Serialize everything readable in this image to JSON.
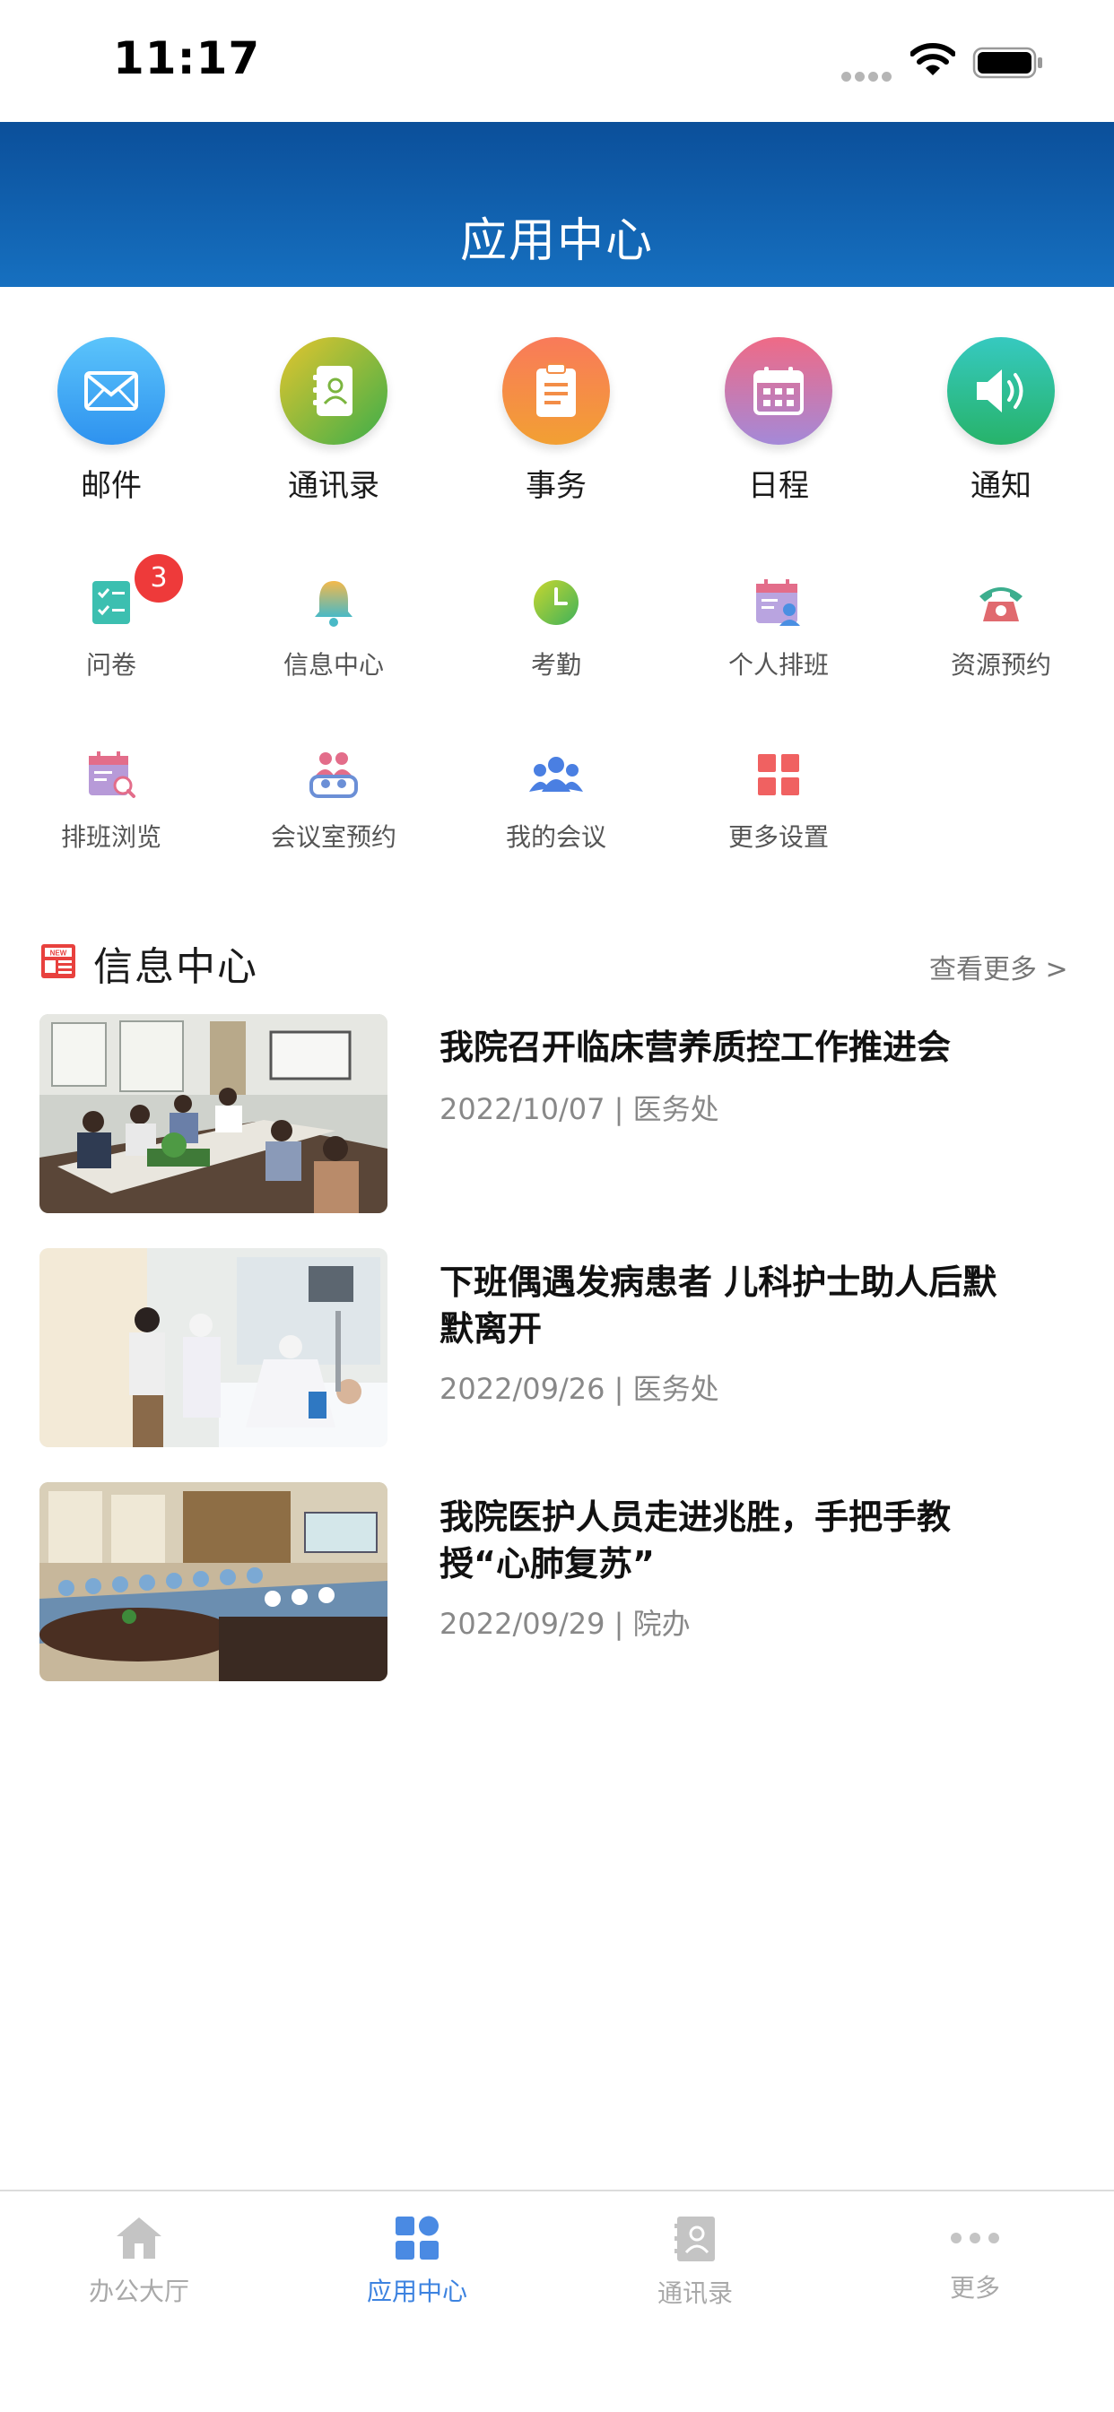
{
  "status_bar": {
    "time": "11:17"
  },
  "header": {
    "title": "应用中心"
  },
  "primary_apps": [
    {
      "label": "邮件",
      "icon": "mail-icon"
    },
    {
      "label": "通讯录",
      "icon": "contacts-icon"
    },
    {
      "label": "事务",
      "icon": "clipboard-icon"
    },
    {
      "label": "日程",
      "icon": "calendar-icon"
    },
    {
      "label": "通知",
      "icon": "speaker-icon"
    }
  ],
  "secondary_apps": [
    {
      "label": "问卷",
      "icon": "checklist-icon",
      "badge": "3"
    },
    {
      "label": "信息中心",
      "icon": "bell-icon"
    },
    {
      "label": "考勤",
      "icon": "clock-icon"
    },
    {
      "label": "个人排班",
      "icon": "personal-schedule-icon"
    },
    {
      "label": "资源预约",
      "icon": "phone-icon"
    },
    {
      "label": "排班浏览",
      "icon": "schedule-browse-icon"
    },
    {
      "label": "会议室预约",
      "icon": "meeting-room-icon"
    },
    {
      "label": "我的会议",
      "icon": "group-icon"
    },
    {
      "label": "更多设置",
      "icon": "grid-icon"
    }
  ],
  "info_center": {
    "title": "信息中心",
    "more": "查看更多 >",
    "news": [
      {
        "title": "我院召开临床营养质控工作推进会",
        "meta": "2022/10/07 | 医务处"
      },
      {
        "title": "下班偶遇发病患者 儿科护士助人后默默离开",
        "meta": "2022/09/26 | 医务处"
      },
      {
        "title": "我院医护人员走进兆胜，手把手教授“心肺复苏”",
        "meta": "2022/09/29 | 院办"
      }
    ]
  },
  "tab_bar": [
    {
      "label": "办公大厅",
      "icon": "home-icon"
    },
    {
      "label": "应用中心",
      "icon": "apps-icon",
      "active": true
    },
    {
      "label": "通讯录",
      "icon": "contacts-book-icon"
    },
    {
      "label": "更多",
      "icon": "more-dots-icon"
    }
  ],
  "colors": {
    "header": "#1670c0",
    "accent": "#3d83e0",
    "badge": "#ee3a3a"
  }
}
